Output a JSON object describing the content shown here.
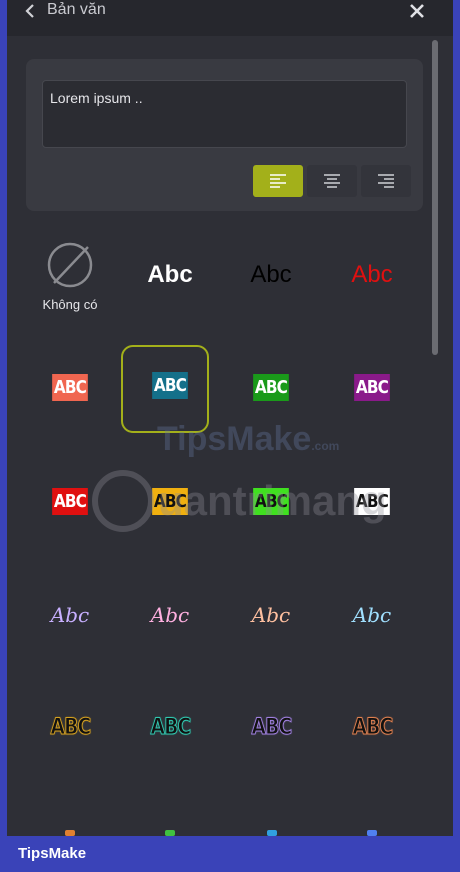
{
  "header": {
    "title": "Bản văn",
    "back_icon": "chevron-left-icon",
    "close_icon": "close-icon"
  },
  "editor": {
    "value": "Lorem ipsum ..",
    "alignment": "left",
    "accent": "#a3b01a"
  },
  "styles": {
    "none_label": "Không có",
    "plain": [
      {
        "text": "Abc",
        "color": "#ffffff",
        "weight": "bold"
      },
      {
        "text": "Abc",
        "color": "#000000",
        "weight": "normal"
      },
      {
        "text": "Abc",
        "color": "#e01010",
        "weight": "normal"
      }
    ],
    "boxed_row1": [
      {
        "text": "ABC",
        "bg": "#f06650",
        "fg": "#ffffff"
      },
      {
        "text": "ABC",
        "bg": "#14708a",
        "fg": "#ffffff",
        "selected": true
      },
      {
        "text": "ABC",
        "bg": "#1a9a1a",
        "fg": "#ffffff"
      },
      {
        "text": "ABC",
        "bg": "#8a1a8a",
        "fg": "#ffffff"
      }
    ],
    "boxed_row2": [
      {
        "text": "ABC",
        "bg": "#e01010",
        "fg": "#ffffff"
      },
      {
        "text": "ABC",
        "bg": "#f0b010",
        "fg": "#111111"
      },
      {
        "text": "ABC",
        "bg": "#40e020",
        "fg": "#111111"
      },
      {
        "text": "ABC",
        "bg": "#ffffff",
        "fg": "#111111"
      }
    ],
    "script": [
      {
        "text": "Abc",
        "color": "#c8b0ff"
      },
      {
        "text": "Abc",
        "color": "#ffb0e0"
      },
      {
        "text": "Abc",
        "color": "#ffc0a0"
      },
      {
        "text": "Abc",
        "color": "#a0e0ff"
      }
    ],
    "outline": [
      {
        "text": "ABC",
        "color": "#d4a020"
      },
      {
        "text": "ABC",
        "color": "#30c8b0"
      },
      {
        "text": "ABC",
        "color": "#a080e0"
      },
      {
        "text": "ABC",
        "color": "#e08050"
      }
    ]
  },
  "watermarks": {
    "tipsmake": "TipsMake",
    "tipsmake_suffix": ".com",
    "quantrimang": "uantrimang"
  },
  "footer": {
    "brand": "TipsMake"
  }
}
